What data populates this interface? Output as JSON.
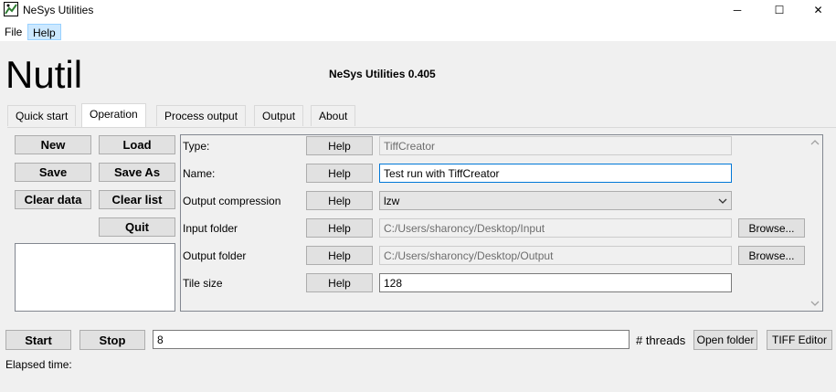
{
  "window": {
    "title": "NeSys Utilities",
    "controls": {
      "minimize": "─",
      "maximize": "☐",
      "close": "✕"
    }
  },
  "menu": {
    "items": [
      "File",
      "Help"
    ]
  },
  "header": {
    "logo": "Nutil",
    "version": "NeSys Utilities 0.405"
  },
  "tabs": [
    "Quick start",
    "Operation",
    "Process output",
    "Output",
    "About"
  ],
  "left_buttons": {
    "new": "New",
    "load": "Load",
    "save": "Save",
    "save_as": "Save As",
    "clear_data": "Clear data",
    "clear_list": "Clear list",
    "quit": "Quit"
  },
  "form": {
    "help_label": "Help",
    "browse_label": "Browse...",
    "rows": {
      "type": {
        "label": "Type:",
        "value": "TiffCreator"
      },
      "name": {
        "label": "Name:",
        "value": "Test run with TiffCreator"
      },
      "compression": {
        "label": "Output compression",
        "value": "lzw"
      },
      "input": {
        "label": "Input folder",
        "value": "C:/Users/sharoncy/Desktop/Input"
      },
      "output": {
        "label": "Output folder",
        "value": "C:/Users/sharoncy/Desktop/Output"
      },
      "tile": {
        "label": "Tile size",
        "value": "128"
      }
    }
  },
  "bottom": {
    "start": "Start",
    "stop": "Stop",
    "threads_value": "8",
    "threads_label": "# threads",
    "open_folder": "Open folder",
    "tiff_editor": "TIFF Editor",
    "elapsed": "Elapsed time:"
  },
  "colors": {
    "accent_focus": "#0078d7",
    "menu_highlight": "#cce8ff"
  }
}
